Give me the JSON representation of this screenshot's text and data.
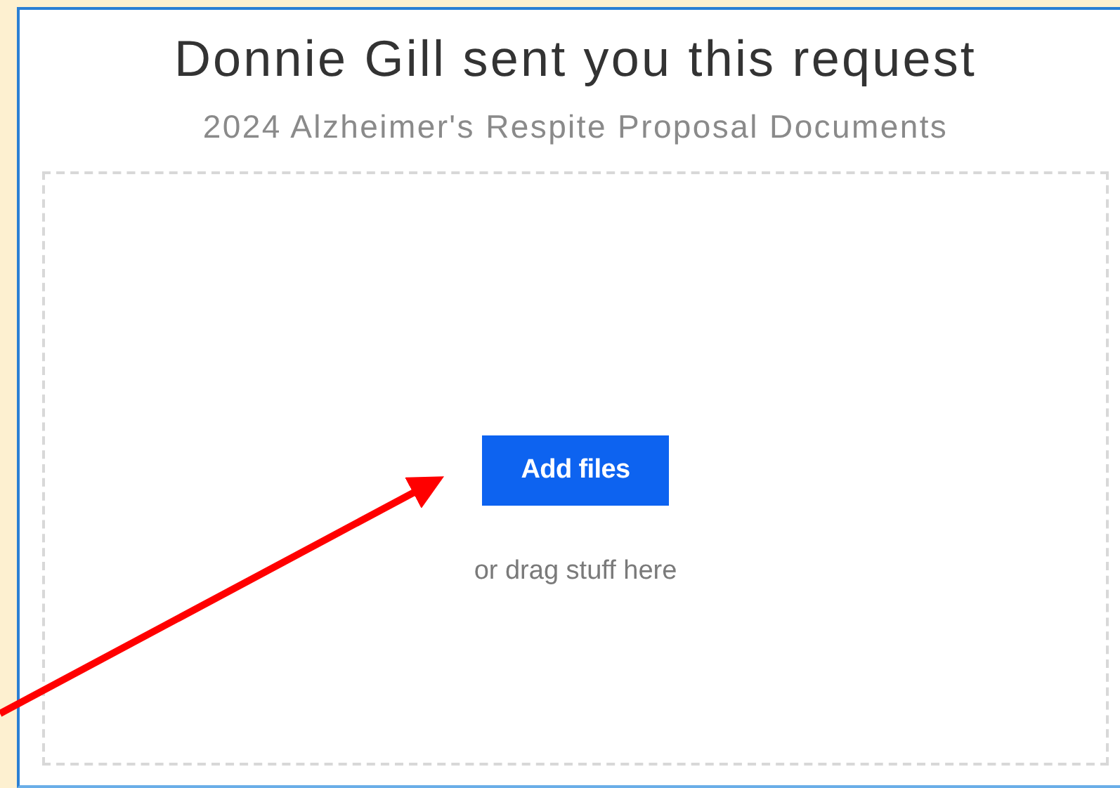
{
  "title": "Donnie Gill sent you this request",
  "subtitle": "2024 Alzheimer's Respite Proposal Documents",
  "drop_zone": {
    "button": "Add files",
    "hint": "or drag stuff here"
  }
}
